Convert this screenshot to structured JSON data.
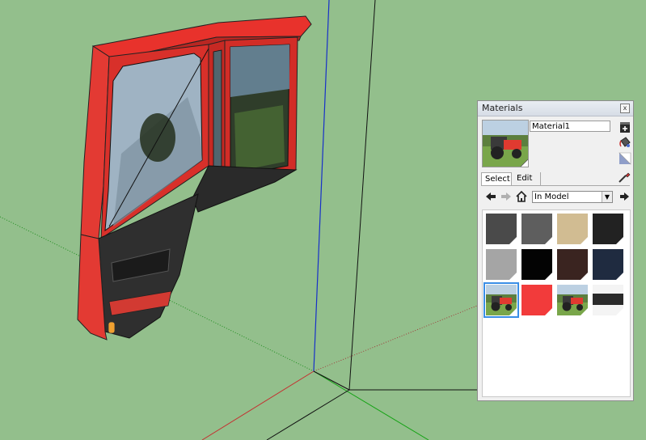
{
  "app": {
    "viewport_background": "#93bf8c",
    "axis_colors": {
      "red": "#c43030",
      "green": "#13a313",
      "blue": "#1730c9"
    }
  },
  "materials_panel": {
    "title": "Materials",
    "close_label": "x",
    "material_name": "Material1",
    "tabs": [
      {
        "label": "Select",
        "active": true
      },
      {
        "label": "Edit",
        "active": false
      }
    ],
    "collection_dropdown": {
      "selected": "In Model",
      "arrow_icon": "chevron-down-icon"
    },
    "nav_icons": [
      "back-arrow-icon",
      "forward-arrow-icon",
      "home-icon",
      "details-arrow-icon"
    ],
    "side_icons": [
      "create-material-icon",
      "paint-bucket-icon",
      "default-material-icon",
      "eyedropper-icon"
    ],
    "swatches": [
      {
        "kind": "color",
        "color": "#4a4a4a"
      },
      {
        "kind": "color",
        "color": "#5e5e5e"
      },
      {
        "kind": "color",
        "color": "#d1bc92"
      },
      {
        "kind": "color",
        "color": "#222222"
      },
      {
        "kind": "color",
        "color": "#a5a5a5"
      },
      {
        "kind": "color",
        "color": "#030303"
      },
      {
        "kind": "color",
        "color": "#3a2420"
      },
      {
        "kind": "color",
        "color": "#1f2b40"
      },
      {
        "kind": "texture",
        "texture": "tractor-photo",
        "selected": true
      },
      {
        "kind": "color",
        "color": "#f23b3b"
      },
      {
        "kind": "texture",
        "texture": "tractor-photo"
      },
      {
        "kind": "texture",
        "texture": "dark-stripe"
      }
    ]
  }
}
